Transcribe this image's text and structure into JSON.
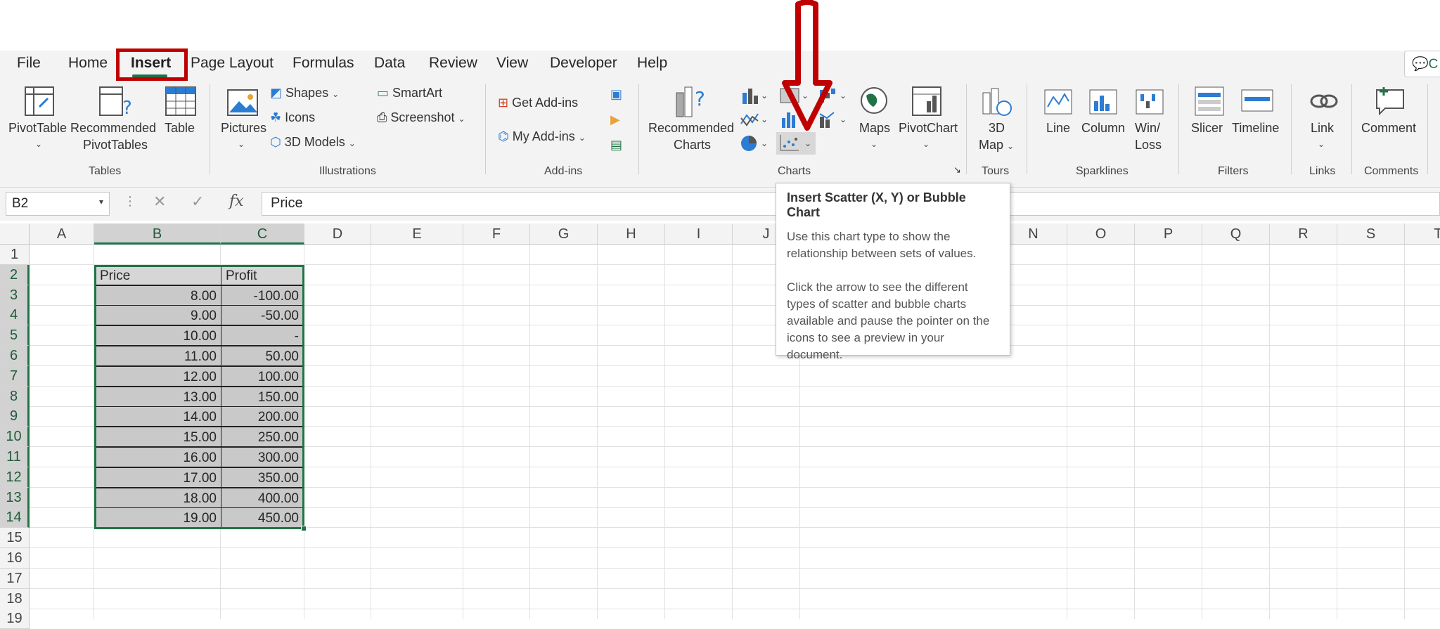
{
  "ribbon_tabs": [
    {
      "label": "File"
    },
    {
      "label": "Home"
    },
    {
      "label": "Insert"
    },
    {
      "label": "Page Layout"
    },
    {
      "label": "Formulas"
    },
    {
      "label": "Data"
    },
    {
      "label": "Review"
    },
    {
      "label": "View"
    },
    {
      "label": "Developer"
    },
    {
      "label": "Help"
    }
  ],
  "active_tab": "Insert",
  "comments_button": {
    "label": "C"
  },
  "tables": {
    "pivottable": "PivotTable",
    "recommended_pivot_1": "Recommended",
    "recommended_pivot_2": "PivotTables",
    "table": "Table",
    "group": "Tables"
  },
  "illustrations": {
    "pictures": "Pictures",
    "shapes": "Shapes",
    "icons": "Icons",
    "models3d": "3D Models",
    "smartart": "SmartArt",
    "screenshot": "Screenshot",
    "group": "Illustrations"
  },
  "addins": {
    "get": "Get Add-ins",
    "my": "My Add-ins",
    "group": "Add-ins"
  },
  "charts": {
    "recommended_1": "Recommended",
    "recommended_2": "Charts",
    "maps": "Maps",
    "pivotchart": "PivotChart",
    "group": "Charts"
  },
  "tours": {
    "map_1": "3D",
    "map_2": "Map",
    "group": "Tours"
  },
  "sparklines": {
    "line": "Line",
    "column": "Column",
    "winloss_1": "Win/",
    "winloss_2": "Loss",
    "group": "Sparklines"
  },
  "filters": {
    "slicer": "Slicer",
    "timeline": "Timeline",
    "group": "Filters"
  },
  "links": {
    "link": "Link",
    "group": "Links"
  },
  "comments": {
    "comment": "Comment",
    "group": "Comments"
  },
  "formula_bar": {
    "name_box": "B2",
    "fx": "fx",
    "value": "Price"
  },
  "columns": [
    "A",
    "B",
    "C",
    "D",
    "E",
    "F",
    "G",
    "H",
    "I",
    "J",
    "N",
    "O",
    "P",
    "Q",
    "R",
    "S",
    "T"
  ],
  "rows": [
    "1",
    "2",
    "3",
    "4",
    "5",
    "6",
    "7",
    "8",
    "9",
    "10",
    "11",
    "12",
    "13",
    "14",
    "15",
    "16",
    "17",
    "18",
    "19"
  ],
  "table": {
    "headers": [
      "Price",
      "Profit"
    ],
    "rows": [
      [
        "8.00",
        "-100.00"
      ],
      [
        "9.00",
        "-50.00"
      ],
      [
        "10.00",
        "-"
      ],
      [
        "11.00",
        "50.00"
      ],
      [
        "12.00",
        "100.00"
      ],
      [
        "13.00",
        "150.00"
      ],
      [
        "14.00",
        "200.00"
      ],
      [
        "15.00",
        "250.00"
      ],
      [
        "16.00",
        "300.00"
      ],
      [
        "17.00",
        "350.00"
      ],
      [
        "18.00",
        "400.00"
      ],
      [
        "19.00",
        "450.00"
      ]
    ]
  },
  "tooltip": {
    "title": "Insert Scatter (X, Y) or Bubble Chart",
    "para1": "Use this chart type to show the relationship between sets of values.",
    "para2": "Click the arrow to see the different types of scatter and bubble charts available and pause the pointer on the icons to see a preview in your document."
  },
  "colors": {
    "excel_green": "#217346",
    "annotation_red": "#c00000"
  }
}
